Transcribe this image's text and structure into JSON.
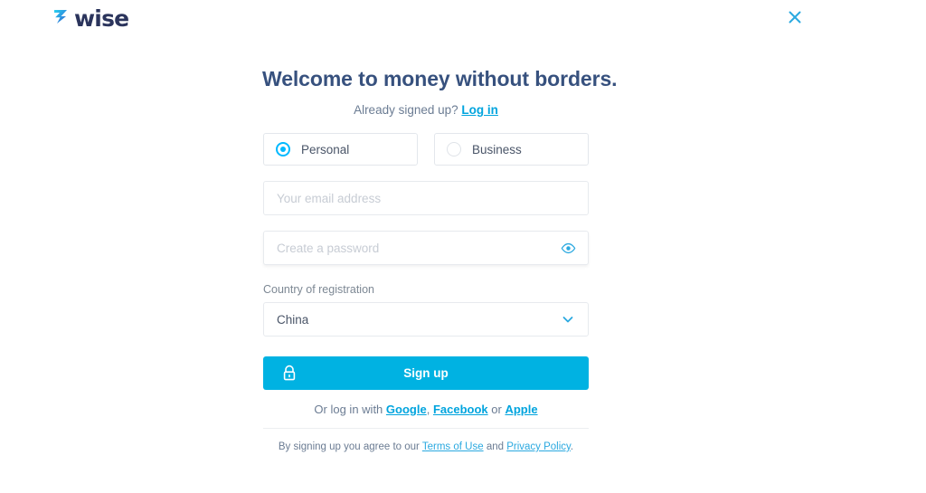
{
  "brand": {
    "name": "wise",
    "logo_mark": "wise-arrow-icon",
    "accent_color": "#00b9ff",
    "logo_text_color": "#2b345c",
    "button_color": "#00b2e2",
    "title_color": "#37517e"
  },
  "header": {
    "close_label": "close-icon"
  },
  "main": {
    "title": "Welcome to money without borders.",
    "already_signed_up": {
      "prefix": "Already signed up?",
      "link": "Log in"
    }
  },
  "account_type": {
    "options": [
      {
        "label": "Personal",
        "selected": true
      },
      {
        "label": "Business",
        "selected": false
      }
    ]
  },
  "form": {
    "email": {
      "placeholder": "Your email address",
      "value": ""
    },
    "password": {
      "placeholder": "Create a password",
      "value": "",
      "toggle_icon": "eye-icon"
    },
    "country": {
      "label": "Country of registration",
      "value": "China",
      "chevron_icon": "chevron-down-icon"
    }
  },
  "submit": {
    "label": "Sign up",
    "icon": "lock-icon"
  },
  "social_login": {
    "prefix": "Or log in with",
    "google": "Google",
    "separator_comma": ",",
    "facebook": "Facebook",
    "separator_or": "or",
    "apple": "Apple"
  },
  "footer": {
    "prefix": "By signing up you agree to our",
    "terms_link": "Terms of Use",
    "conjunction": "and",
    "privacy_link": "Privacy Policy",
    "period": "."
  }
}
